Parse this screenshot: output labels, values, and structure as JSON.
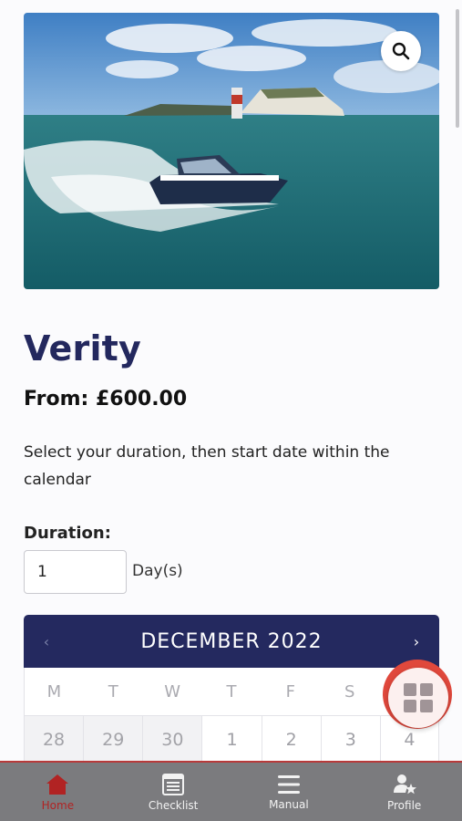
{
  "hero": {
    "image_alt": "Motor boat cruising past The Needles lighthouse",
    "zoom_icon": "search-icon"
  },
  "product": {
    "title": "Verity",
    "price": "From: £600.00",
    "instructions": "Select your duration, then start date within the calendar"
  },
  "duration": {
    "label": "Duration:",
    "value": "1",
    "unit": "Day(s)"
  },
  "calendar": {
    "month": "DECEMBER 2022",
    "prev_icon": "‹",
    "next_icon": "›",
    "weekdays": [
      "M",
      "T",
      "W",
      "T",
      "F",
      "S",
      "S"
    ],
    "first_week": [
      "28",
      "29",
      "30",
      "1",
      "2",
      "3",
      "4"
    ]
  },
  "fab": {
    "icon": "grid-icon"
  },
  "nav": [
    {
      "label": "Home",
      "icon": "home-icon",
      "active": true
    },
    {
      "label": "Checklist",
      "icon": "checklist-icon",
      "active": false
    },
    {
      "label": "Manual",
      "icon": "menu-icon",
      "active": false
    },
    {
      "label": "Profile",
      "icon": "profile-star-icon",
      "active": false
    }
  ],
  "colors": {
    "navy": "#24295f",
    "accent_red": "#b12323",
    "fab_red": "#e0483c",
    "nav_bg": "#7b7b7e"
  }
}
